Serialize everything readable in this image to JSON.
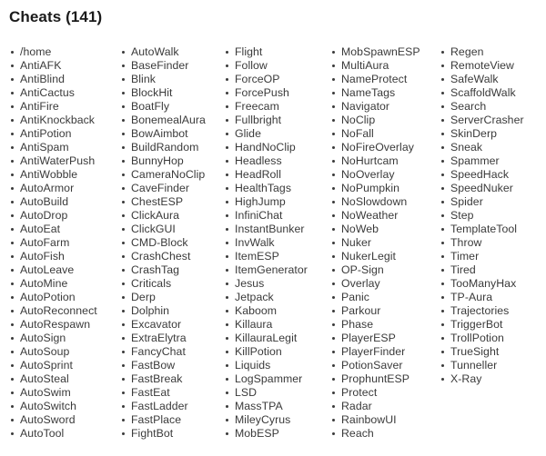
{
  "header": {
    "title": "Cheats (141)",
    "label": "Cheats",
    "count": 141
  },
  "colors": {
    "background": "#ffffff",
    "title_text": "#1b1b1b",
    "item_text": "#3a3a3a",
    "bullet": "#3a3a3a"
  },
  "list": {
    "total_items": 141,
    "column_count": 5,
    "columns": [
      {
        "index": 1,
        "item_count": 29,
        "items": [
          "/home",
          "AntiAFK",
          "AntiBlind",
          "AntiCactus",
          "AntiFire",
          "AntiKnockback",
          "AntiPotion",
          "AntiSpam",
          "AntiWaterPush",
          "AntiWobble",
          "AutoArmor",
          "AutoBuild",
          "AutoDrop",
          "AutoEat",
          "AutoFarm",
          "AutoFish",
          "AutoLeave",
          "AutoMine",
          "AutoPotion",
          "AutoReconnect",
          "AutoRespawn",
          "AutoSign",
          "AutoSoup",
          "AutoSprint",
          "AutoSteal",
          "AutoSwim",
          "AutoSwitch",
          "AutoSword",
          "AutoTool"
        ]
      },
      {
        "index": 2,
        "item_count": 29,
        "items": [
          "AutoWalk",
          "BaseFinder",
          "Blink",
          "BlockHit",
          "BoatFly",
          "BonemealAura",
          "BowAimbot",
          "BuildRandom",
          "BunnyHop",
          "CameraNoClip",
          "CaveFinder",
          "ChestESP",
          "ClickAura",
          "ClickGUI",
          "CMD-Block",
          "CrashChest",
          "CrashTag",
          "Criticals",
          "Derp",
          "Dolphin",
          "Excavator",
          "ExtraElytra",
          "FancyChat",
          "FastBow",
          "FastBreak",
          "FastEat",
          "FastLadder",
          "FastPlace",
          "FightBot"
        ]
      },
      {
        "index": 3,
        "item_count": 29,
        "items": [
          "Flight",
          "Follow",
          "ForceOP",
          "ForcePush",
          "Freecam",
          "Fullbright",
          "Glide",
          "HandNoClip",
          "Headless",
          "HeadRoll",
          "HealthTags",
          "HighJump",
          "InfiniChat",
          "InstantBunker",
          "InvWalk",
          "ItemESP",
          "ItemGenerator",
          "Jesus",
          "Jetpack",
          "Kaboom",
          "Killaura",
          "KillauraLegit",
          "KillPotion",
          "Liquids",
          "LogSpammer",
          "LSD",
          "MassTPA",
          "MileyCyrus",
          "MobESP"
        ]
      },
      {
        "index": 4,
        "item_count": 29,
        "items": [
          "MobSpawnESP",
          "MultiAura",
          "NameProtect",
          "NameTags",
          "Navigator",
          "NoClip",
          "NoFall",
          "NoFireOverlay",
          "NoHurtcam",
          "NoOverlay",
          "NoPumpkin",
          "NoSlowdown",
          "NoWeather",
          "NoWeb",
          "Nuker",
          "NukerLegit",
          "OP-Sign",
          "Overlay",
          "Panic",
          "Parkour",
          "Phase",
          "PlayerESP",
          "PlayerFinder",
          "PotionSaver",
          "ProphuntESP",
          "Protect",
          "Radar",
          "RainbowUI",
          "Reach"
        ]
      },
      {
        "index": 5,
        "item_count": 25,
        "items": [
          "Regen",
          "RemoteView",
          "SafeWalk",
          "ScaffoldWalk",
          "Search",
          "ServerCrasher",
          "SkinDerp",
          "Sneak",
          "Spammer",
          "SpeedHack",
          "SpeedNuker",
          "Spider",
          "Step",
          "TemplateTool",
          "Throw",
          "Timer",
          "Tired",
          "TooManyHax",
          "TP-Aura",
          "Trajectories",
          "TriggerBot",
          "TrollPotion",
          "TrueSight",
          "Tunneller",
          "X-Ray"
        ]
      }
    ]
  }
}
